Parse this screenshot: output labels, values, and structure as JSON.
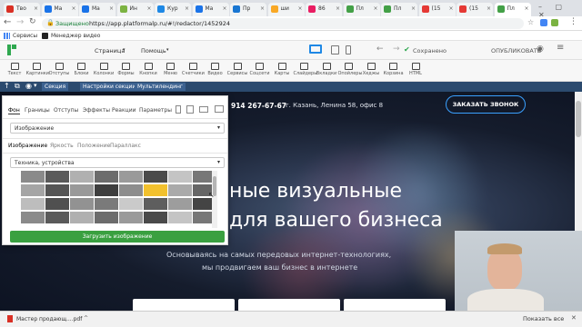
{
  "browser": {
    "tabs": [
      {
        "label": "Тво",
        "color": "#d93025"
      },
      {
        "label": "Ма",
        "color": "#1a73e8"
      },
      {
        "label": "Ма",
        "color": "#1a73e8"
      },
      {
        "label": "Ин",
        "color": "#7cb342"
      },
      {
        "label": "Кур",
        "color": "#1e88e5"
      },
      {
        "label": "Ма",
        "color": "#1a73e8"
      },
      {
        "label": "Пр",
        "color": "#1976d2"
      },
      {
        "label": "ши",
        "color": "#f9a825"
      },
      {
        "label": "86",
        "color": "#e91e63"
      },
      {
        "label": "Пл",
        "color": "#43a047"
      },
      {
        "label": "Пл",
        "color": "#43a047"
      },
      {
        "label": "(15",
        "color": "#e53935"
      },
      {
        "label": "(15",
        "color": "#e53935"
      },
      {
        "label": "Пл",
        "color": "#43a047"
      }
    ],
    "secure_label": "Защищено",
    "url": "https://app.platformalp.ru/#!/redactor/1452924",
    "bookmarks": [
      {
        "label": "Сервисы"
      },
      {
        "label": "Менеджер видео"
      }
    ]
  },
  "editor": {
    "page_menu": "Страница",
    "help_menu": "Помощь",
    "saved_label": "Сохранено",
    "publish_label": "ОПУБЛИКОВАТЬ",
    "tools": [
      "Текст",
      "Картинки",
      "Отступы",
      "Блоки",
      "Колонки",
      "Формы",
      "Кнопки",
      "Меню",
      "Счетчики",
      "Видео",
      "Сервисы",
      "Соцсети",
      "Карты",
      "Слайдеры",
      "Вкладки",
      "Опойлеры",
      "Хеджы",
      "Корзина",
      "HTML"
    ],
    "section_buttons": [
      "Секция",
      "Настройки секции",
      "Мультилендинг"
    ]
  },
  "panel": {
    "tabs": [
      "Фон",
      "Границы",
      "Отступы",
      "Эффекты",
      "Реакции",
      "Параметры"
    ],
    "type_select": "Изображение",
    "subtabs": [
      "Изображение",
      "Яркость",
      "Положение",
      "Параллакс"
    ],
    "category_select": "Техника, устройства",
    "upload_button": "Загрузить изображение"
  },
  "site": {
    "phone": "914 267-67-67",
    "address": "г. Казань, Ленина 58, офис 8",
    "cta": "ЗАКАЗАТЬ ЗВОНОК",
    "headline_line1": "ные визуальные",
    "headline_line2": "для вашего бизнеса",
    "subtitle_line1": "Основываясь на самых передовых интернет-технологиях,",
    "subtitle_line2": "мы продвигаем ваш бизнес в интернете"
  },
  "statusbar": {
    "download": "Мастер продающ....pdf",
    "show_all": "Показать все"
  }
}
